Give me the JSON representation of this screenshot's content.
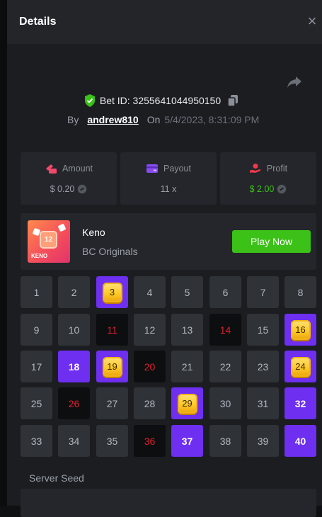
{
  "header": {
    "title": "Details",
    "close_label": "×"
  },
  "bet": {
    "id_label": "Bet ID: 3255641044950150",
    "by_label": "By",
    "username": "andrew810",
    "on_label": "On",
    "date": "5/4/2023, 8:31:09 PM"
  },
  "stats": {
    "amount": {
      "label": "Amount",
      "value": "$ 0.20"
    },
    "payout": {
      "label": "Payout",
      "value": "11 x"
    },
    "profit": {
      "label": "Profit",
      "value": "$ 2.00"
    }
  },
  "game": {
    "thumb_number": "12",
    "thumb_label": "KENO",
    "name": "Keno",
    "provider": "BC Originals",
    "play_label": "Play Now"
  },
  "keno": {
    "cells": [
      {
        "n": "1",
        "state": "normal"
      },
      {
        "n": "2",
        "state": "normal"
      },
      {
        "n": "3",
        "state": "hit-gem"
      },
      {
        "n": "4",
        "state": "normal"
      },
      {
        "n": "5",
        "state": "normal"
      },
      {
        "n": "6",
        "state": "normal"
      },
      {
        "n": "7",
        "state": "normal"
      },
      {
        "n": "8",
        "state": "normal"
      },
      {
        "n": "9",
        "state": "normal"
      },
      {
        "n": "10",
        "state": "normal"
      },
      {
        "n": "11",
        "state": "miss"
      },
      {
        "n": "12",
        "state": "normal"
      },
      {
        "n": "13",
        "state": "normal"
      },
      {
        "n": "14",
        "state": "miss"
      },
      {
        "n": "15",
        "state": "normal"
      },
      {
        "n": "16",
        "state": "hit-gem"
      },
      {
        "n": "17",
        "state": "normal"
      },
      {
        "n": "18",
        "state": "hit"
      },
      {
        "n": "19",
        "state": "hit-gem"
      },
      {
        "n": "20",
        "state": "miss"
      },
      {
        "n": "21",
        "state": "normal"
      },
      {
        "n": "22",
        "state": "normal"
      },
      {
        "n": "23",
        "state": "normal"
      },
      {
        "n": "24",
        "state": "hit-gem"
      },
      {
        "n": "25",
        "state": "normal"
      },
      {
        "n": "26",
        "state": "miss"
      },
      {
        "n": "27",
        "state": "normal"
      },
      {
        "n": "28",
        "state": "normal"
      },
      {
        "n": "29",
        "state": "hit-gem"
      },
      {
        "n": "30",
        "state": "normal"
      },
      {
        "n": "31",
        "state": "normal"
      },
      {
        "n": "32",
        "state": "hit"
      },
      {
        "n": "33",
        "state": "normal"
      },
      {
        "n": "34",
        "state": "normal"
      },
      {
        "n": "35",
        "state": "normal"
      },
      {
        "n": "36",
        "state": "miss"
      },
      {
        "n": "37",
        "state": "hit"
      },
      {
        "n": "38",
        "state": "normal"
      },
      {
        "n": "39",
        "state": "normal"
      },
      {
        "n": "40",
        "state": "hit"
      }
    ]
  },
  "seed": {
    "label": "Server Seed"
  },
  "colors": {
    "accent_purple": "#6e2ff0",
    "play_green": "#3bc117",
    "miss_red": "#e0202e",
    "gem_gold": "#ffc927"
  }
}
